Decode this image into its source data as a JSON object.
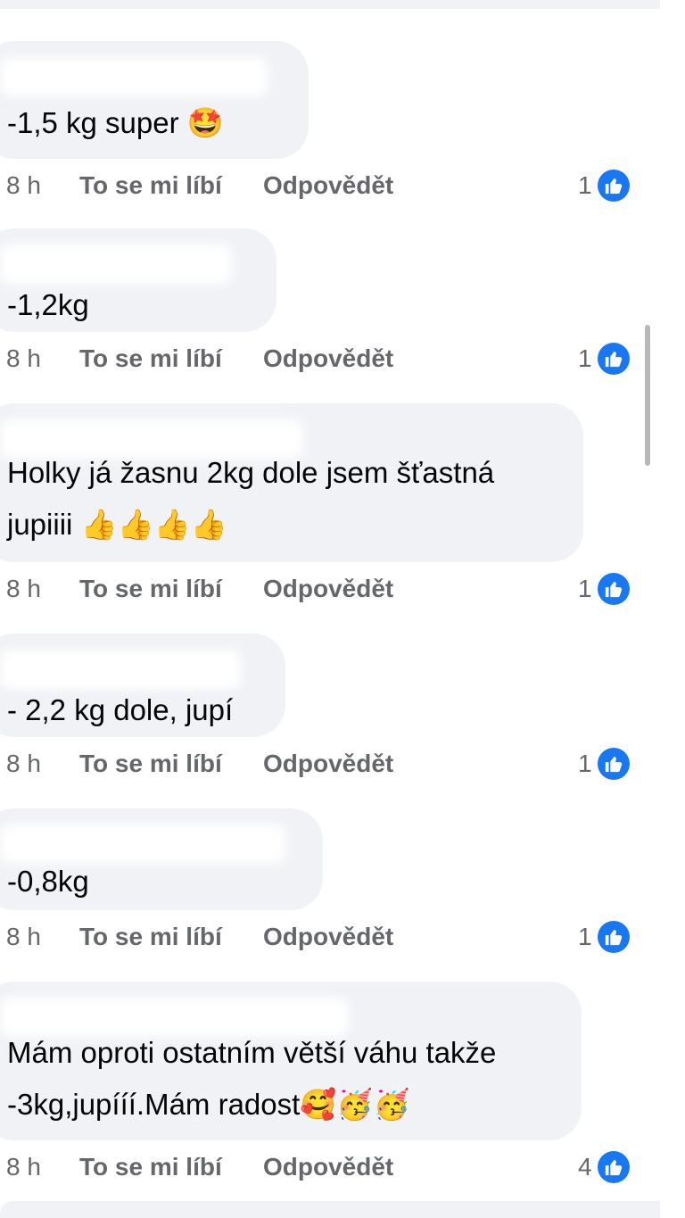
{
  "colors": {
    "bubble": "#f0f2f5",
    "text": "#050505",
    "meta": "#65676b",
    "like_badge": "#1877f2"
  },
  "comments": [
    {
      "text": "-1,5 kg super 🤩",
      "time": "8 h",
      "like_label": "To se mi líbí",
      "reply_label": "Odpovědět",
      "like_count": "1",
      "reaction_icon": "thumbs-up-icon"
    },
    {
      "text": "-1,2kg",
      "time": "8 h",
      "like_label": "To se mi líbí",
      "reply_label": "Odpovědět",
      "like_count": "1",
      "reaction_icon": "thumbs-up-icon"
    },
    {
      "text_line1": "Holky já žasnu 2kg dole jsem  šťastná",
      "text_line2": "jupiiii 👍👍👍👍",
      "time": "8 h",
      "like_label": "To se mi líbí",
      "reply_label": "Odpovědět",
      "like_count": "1",
      "reaction_icon": "thumbs-up-icon"
    },
    {
      "text": "- 2,2 kg dole, jupí",
      "time": "8 h",
      "like_label": "To se mi líbí",
      "reply_label": "Odpovědět",
      "like_count": "1",
      "reaction_icon": "thumbs-up-icon"
    },
    {
      "text": "-0,8kg",
      "time": "8 h",
      "like_label": "To se mi líbí",
      "reply_label": "Odpovědět",
      "like_count": "1",
      "reaction_icon": "thumbs-up-icon"
    },
    {
      "text_line1": "Mám oproti ostatním větší váhu takže",
      "text_line2": "-3kg,jupííí.Mám radost🥰🥳🥳",
      "time": "8 h",
      "like_label": "To se mi líbí",
      "reply_label": "Odpovědět",
      "like_count": "4",
      "reaction_icon": "thumbs-up-icon"
    }
  ]
}
